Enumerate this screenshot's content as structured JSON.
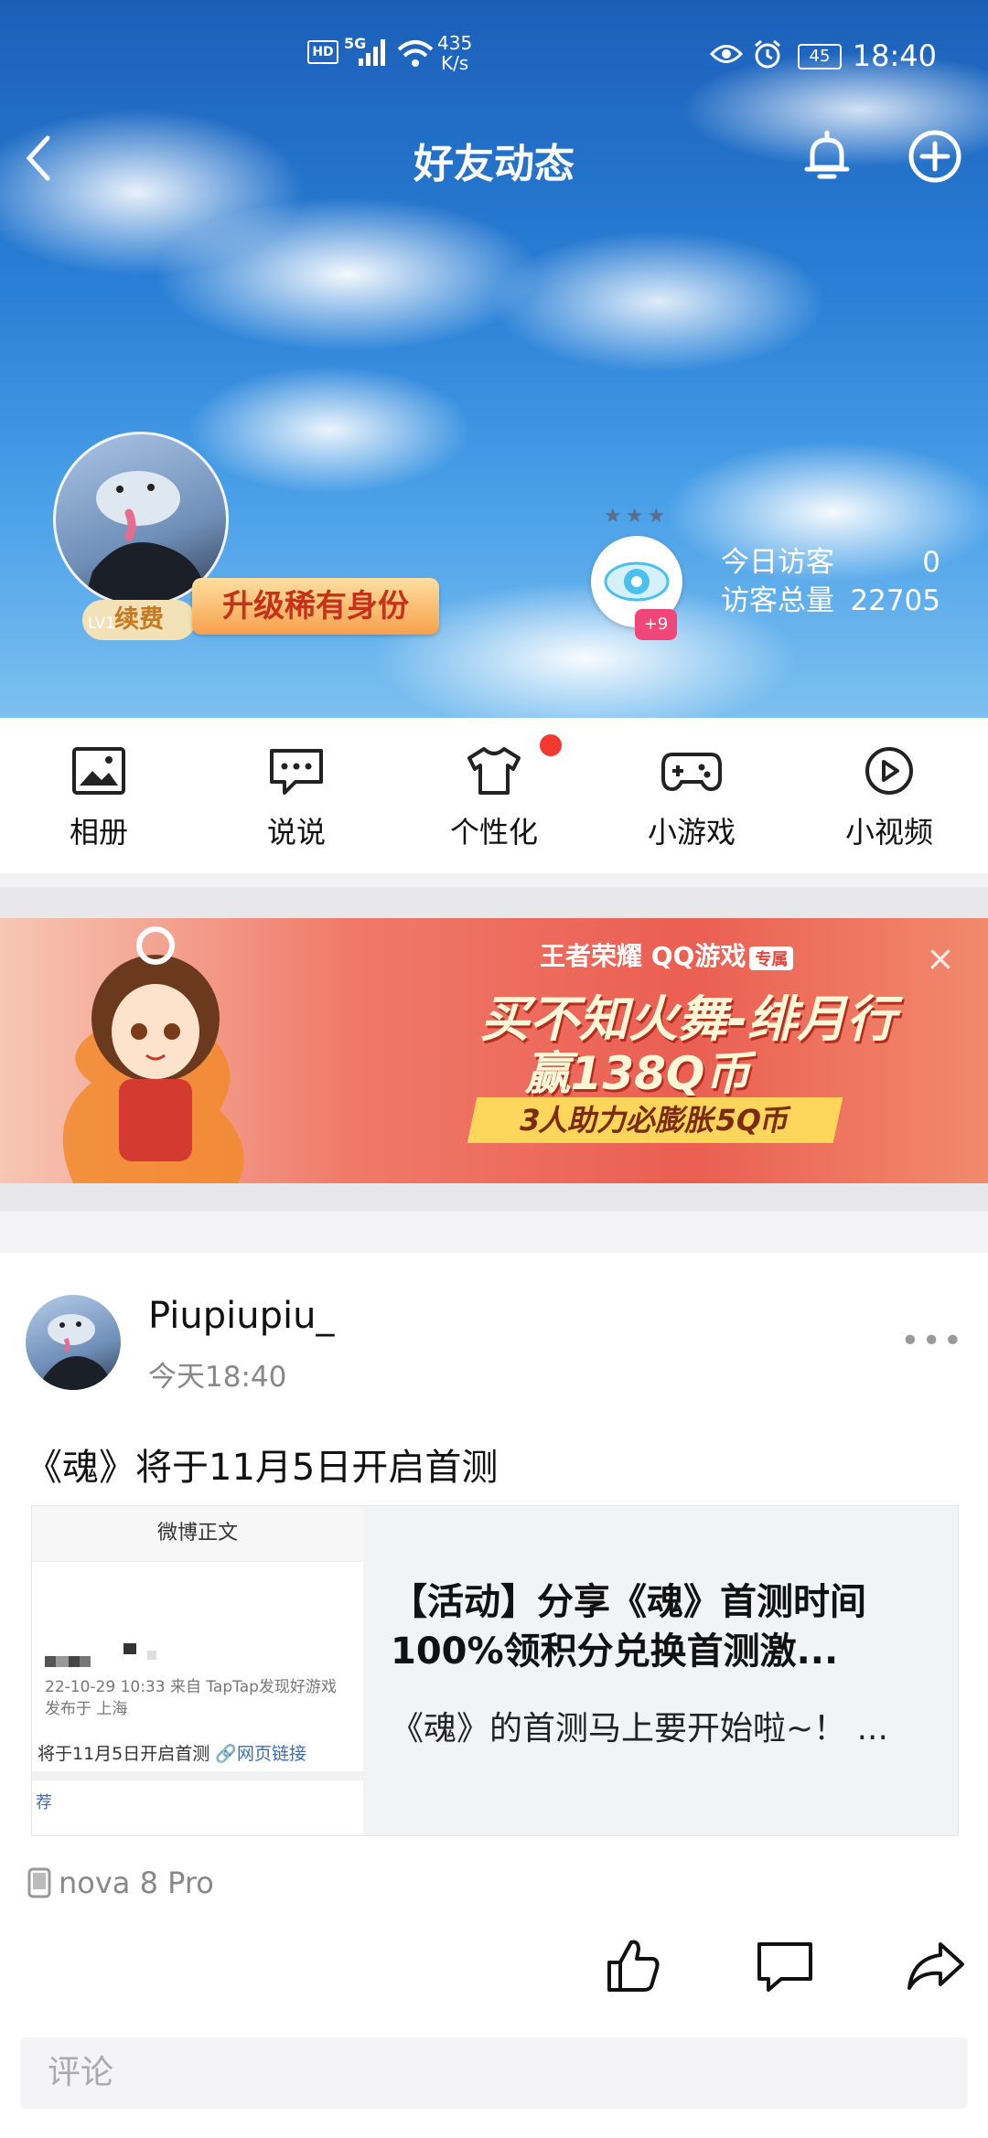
{
  "status_bar": {
    "hd": "HD",
    "net_type": "5G",
    "speed_value": "435",
    "speed_unit": "K/s",
    "battery": "45",
    "time": "18:40"
  },
  "header": {
    "title": "好友动态"
  },
  "profile": {
    "renew_label": "续费",
    "level": "LV1",
    "upgrade_label": "升级稀有身份",
    "visitor_badge": "+9",
    "today_label": "今日访客",
    "today_value": "0",
    "total_label": "访客总量",
    "total_value": "22705"
  },
  "menu": {
    "items": [
      {
        "label": "相册",
        "icon": "album-icon"
      },
      {
        "label": "说说",
        "icon": "chat-bubble-icon"
      },
      {
        "label": "个性化",
        "icon": "tshirt-icon"
      },
      {
        "label": "小游戏",
        "icon": "gamepad-icon"
      },
      {
        "label": "小视频",
        "icon": "play-icon"
      }
    ]
  },
  "ad": {
    "brand": "王者荣耀 QQ游戏",
    "brand_tag": "专属",
    "line1": "买不知火舞-绯月行",
    "line2": "赢138Q币",
    "line3": "3人助力必膨胀5Q币",
    "close": "×"
  },
  "post": {
    "author": "Piupiupiu_",
    "time": "今天18:40",
    "text": "《魂》将于11月5日开启首测",
    "card": {
      "thumb_header": "微博正文",
      "thumb_meta_1": "22-10-29 10:33  来自 TapTap发现好游戏",
      "thumb_meta_2": "发布于 上海",
      "thumb_msg": "将于11月5日开启首测",
      "thumb_link": "网页链接",
      "thumb_rec": "荐",
      "title": "【活动】分享《魂》首测时间 100%领积分兑换首测激...",
      "summary": "《魂》的首测马上要开始啦~！ ..."
    },
    "device": "nova 8 Pro",
    "comment_placeholder": "评论"
  }
}
